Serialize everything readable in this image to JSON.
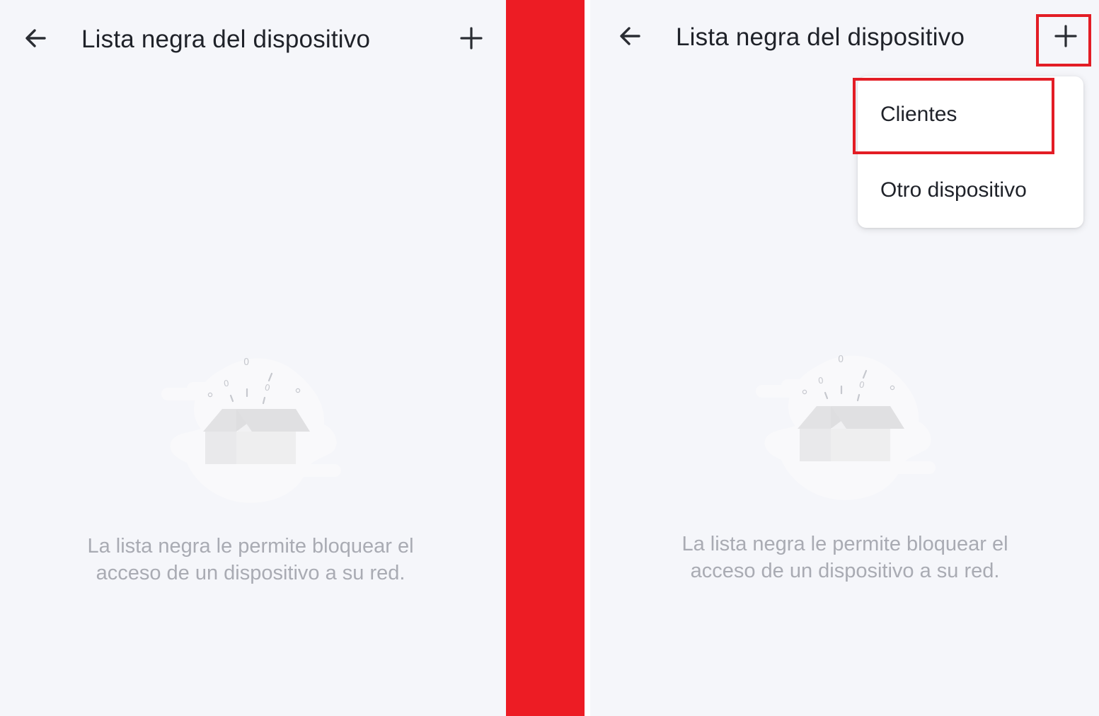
{
  "screens": [
    {
      "title": "Lista negra del dispositivo",
      "icons": {
        "back": "arrow-left-icon",
        "add": "plus-icon",
        "illustration": "empty-box-illustration"
      },
      "empty_message": {
        "line1": "La lista negra le permite bloquear el",
        "line2": "acceso de un dispositivo a su red."
      }
    },
    {
      "title": "Lista negra del dispositivo",
      "icons": {
        "back": "arrow-left-icon",
        "add": "plus-icon",
        "illustration": "empty-box-illustration"
      },
      "empty_message": {
        "line1": "La lista negra le permite bloquear el",
        "line2": "acceso de un dispositivo a su red."
      },
      "add_menu": {
        "items": [
          {
            "label": "Clientes"
          },
          {
            "label": "Otro dispositivo"
          }
        ]
      }
    }
  ],
  "colors": {
    "screen_background": "#f5f6fa",
    "divider": "#ed1c24",
    "highlight": "#e31d25",
    "title_text": "#1f2229",
    "muted_text": "#a9abb3"
  }
}
